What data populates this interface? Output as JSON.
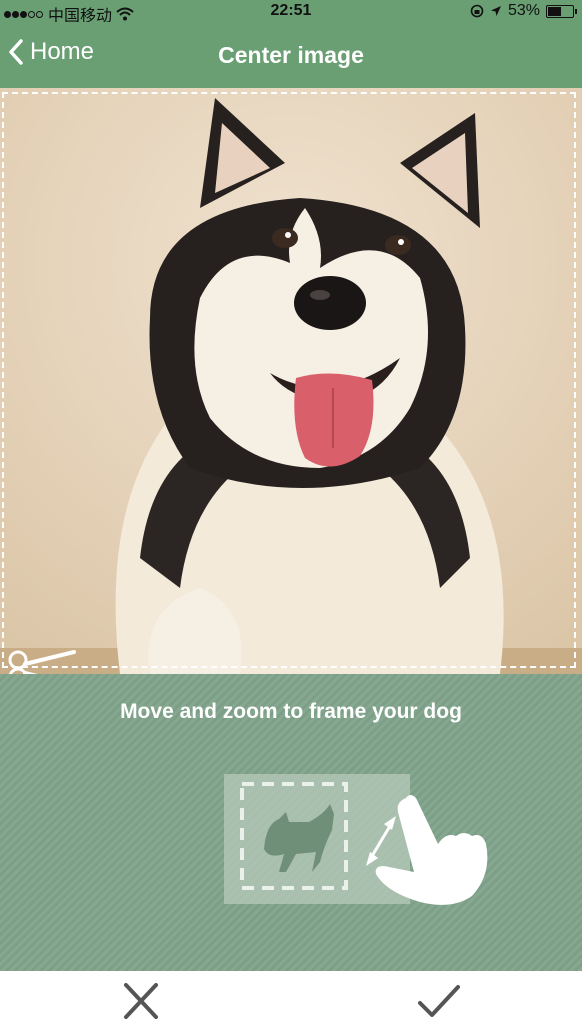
{
  "status_bar": {
    "carrier": "中国移动",
    "time": "22:51",
    "battery_percent": "53%",
    "battery_level": 0.53
  },
  "nav": {
    "back_label": "Home",
    "title": "Center image"
  },
  "editor": {
    "instruction": "Move and zoom to frame your dog"
  },
  "colors": {
    "nav_green": "#6a9f74",
    "panel_green": "#86a890"
  },
  "icons": {
    "back": "chevron-left-icon",
    "crop": "scissors-icon",
    "gesture": "pinch-zoom-gesture-icon",
    "cancel": "close-icon",
    "confirm": "checkmark-icon"
  }
}
